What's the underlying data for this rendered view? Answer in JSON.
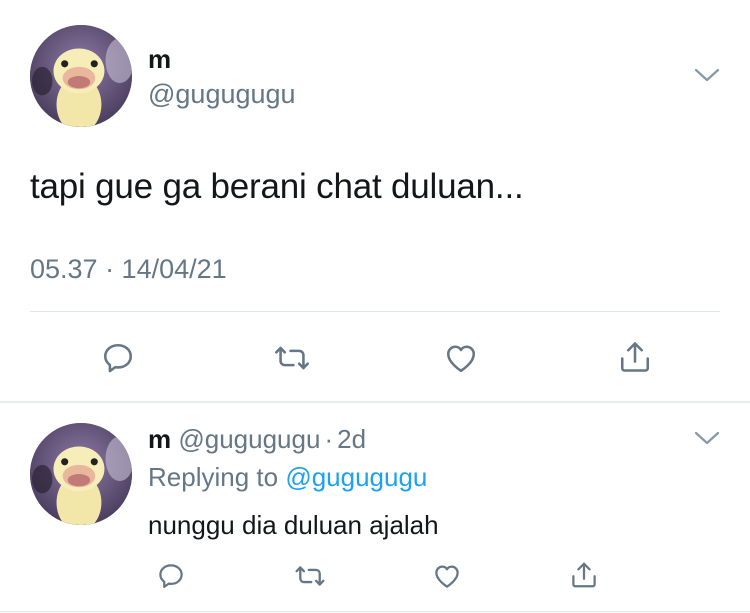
{
  "main_tweet": {
    "display_name": "m",
    "handle": "@gugugugu",
    "text": "tapi gue ga berani chat duluan...",
    "timestamp": "05.37 · 14/04/21",
    "avatar": "duck-avatar"
  },
  "reply": {
    "display_name": "m",
    "handle": "@gugugugu",
    "separator": "·",
    "age": "2d",
    "replying_prefix": "Replying to",
    "replying_to": "@gugugugu",
    "text": "nunggu dia duluan ajalah",
    "avatar": "duck-avatar"
  },
  "icons": {
    "reply": "reply-icon",
    "retweet": "retweet-icon",
    "like": "heart-icon",
    "share": "share-icon",
    "more": "chevron-down-icon"
  },
  "colors": {
    "text_primary": "#14171a",
    "text_secondary": "#657786",
    "link": "#1da1f2",
    "divider": "#e1e8ed"
  }
}
